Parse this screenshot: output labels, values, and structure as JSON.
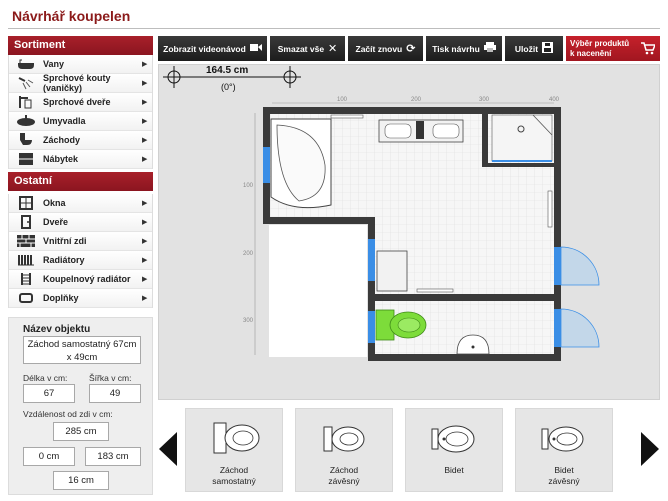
{
  "app": {
    "title": "Návrhář koupelen"
  },
  "sidebar": {
    "assortment_title": "Sortiment",
    "assortment": [
      {
        "label": "Vany",
        "icon": "bathtub-icon"
      },
      {
        "label": "Sprchové kouty (vaničky)",
        "icon": "shower-tray-icon"
      },
      {
        "label": "Sprchové dveře",
        "icon": "shower-door-icon"
      },
      {
        "label": "Umyvadla",
        "icon": "washbasin-icon"
      },
      {
        "label": "Záchody",
        "icon": "toilet-icon"
      },
      {
        "label": "Nábytek",
        "icon": "cabinet-icon"
      }
    ],
    "other_title": "Ostatní",
    "other": [
      {
        "label": "Okna",
        "icon": "window-icon"
      },
      {
        "label": "Dveře",
        "icon": "door-icon"
      },
      {
        "label": "Vnitřní zdi",
        "icon": "wall-icon"
      },
      {
        "label": "Radiátory",
        "icon": "radiator-icon"
      },
      {
        "label": "Koupelnový radiátor",
        "icon": "towel-radiator-icon"
      },
      {
        "label": "Doplňky",
        "icon": "accessory-icon"
      }
    ]
  },
  "properties": {
    "title": "Název objektu",
    "name_line1": "Záchod samostatný 67cm",
    "name_line2": "x 49cm",
    "length_label": "Délka v cm:",
    "length_value": "67",
    "width_label": "Šířka v cm:",
    "width_value": "49",
    "wall_distance_label": "Vzdálenost od zdi v cm:",
    "dist_top": "285 cm",
    "dist_left": "0 cm",
    "dist_right": "183 cm",
    "dist_bottom": "16 cm"
  },
  "toolbar": {
    "video": "Zobrazit videonávod",
    "clear": "Smazat vše",
    "restart": "Začít znovu",
    "print": "Tisk návrhu",
    "save": "Uložit",
    "quote_line1": "Výběr produktů",
    "quote_line2": "k nacenění"
  },
  "canvas": {
    "dimension_value": "164.5 cm",
    "dimension_angle": "(0°)",
    "ruler_top": [
      "100",
      "200",
      "300",
      "400"
    ],
    "ruler_left": [
      "100",
      "200",
      "300"
    ]
  },
  "carousel": [
    {
      "line1": "Záchod",
      "line2": "samostatný",
      "icon": "toilet-standing-icon"
    },
    {
      "line1": "Záchod",
      "line2": "závěsný",
      "icon": "toilet-hanging-icon"
    },
    {
      "line1": "Bidet",
      "line2": "",
      "icon": "bidet-standing-icon"
    },
    {
      "line1": "Bidet",
      "line2": "závěsný",
      "icon": "bidet-hanging-icon"
    }
  ],
  "colors": {
    "brand": "#8b1a1a",
    "window": "#3a8ee6",
    "selected": "#7ddc3a",
    "wall": "#3a3a3a"
  }
}
